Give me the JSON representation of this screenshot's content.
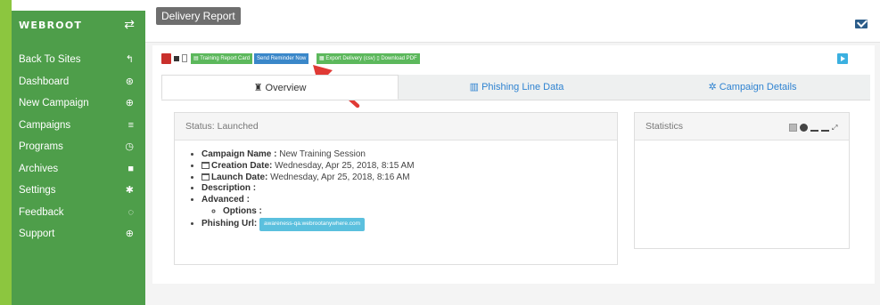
{
  "sidebar": {
    "brand": "WEBROOT",
    "brand_icon": "exchange-icon",
    "items": [
      {
        "label": "Back To Sites",
        "icon": "reply-icon",
        "glyph": "↰"
      },
      {
        "label": "Dashboard",
        "icon": "dashboard-icon",
        "glyph": "⊛"
      },
      {
        "label": "New Campaign",
        "icon": "plus-circle-icon",
        "glyph": "⊕"
      },
      {
        "label": "Campaigns",
        "icon": "list-icon",
        "glyph": "≡"
      },
      {
        "label": "Programs",
        "icon": "clock-icon",
        "glyph": "◷"
      },
      {
        "label": "Archives",
        "icon": "archive-icon",
        "glyph": "■"
      },
      {
        "label": "Settings",
        "icon": "gear-icon",
        "glyph": "✱"
      },
      {
        "label": "Feedback",
        "icon": "comment-icon",
        "glyph": "◌"
      },
      {
        "label": "Support",
        "icon": "lifebuoy-icon",
        "glyph": "⊕"
      }
    ]
  },
  "header": {
    "title": "Delivery Report",
    "mail_icon": "envelope-icon"
  },
  "toolbar": {
    "training_report_card": "Training Report Card",
    "send_reminder": "Send Reminder Now",
    "export_delivery": "Export Delivery (csv)",
    "download_pdf": "Download PDF"
  },
  "tabs": [
    {
      "label": "Overview",
      "icon": "binoculars-icon"
    },
    {
      "label": "Phishing Line Data",
      "icon": "bar-chart-icon"
    },
    {
      "label": "Campaign Details",
      "icon": "cogs-icon"
    }
  ],
  "status_panel": {
    "title": "Status: Launched",
    "campaign_name_label": "Campaign Name :",
    "campaign_name": "New Training Session",
    "creation_date_label": "Creation Date:",
    "creation_date": "Wednesday, Apr 25, 2018, 8:15 AM",
    "launch_date_label": "Launch Date:",
    "launch_date": "Wednesday, Apr 25, 2018, 8:16 AM",
    "description_label": "Description :",
    "advanced_label": "Advanced :",
    "options_label": "Options :",
    "phishing_url_label": "Phishing Url:",
    "phishing_url": "awareness-qa.webrootanywhere.com"
  },
  "statistics_panel": {
    "title": "Statistics"
  },
  "colors": {
    "sidebar": "#4e9e4a",
    "accent": "#8cc63f",
    "link": "#2f83d1",
    "annotation_arrow": "#e03a35"
  }
}
